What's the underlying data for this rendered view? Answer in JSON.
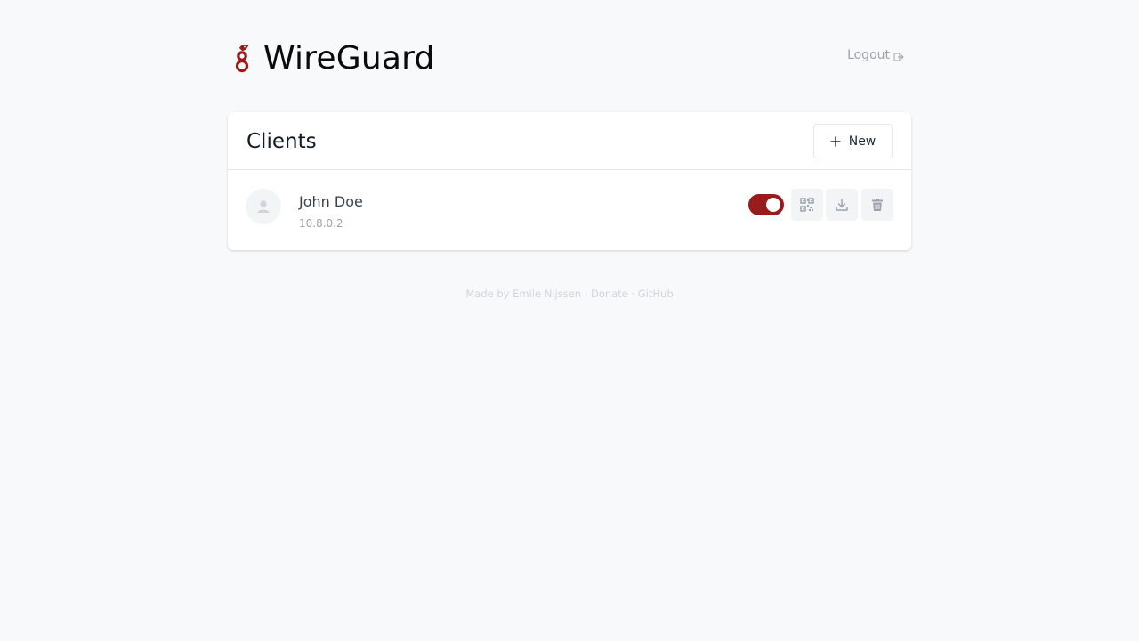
{
  "app": {
    "title": "WireGuard",
    "brand_color": "#991b1b"
  },
  "header": {
    "logout_label": "Logout"
  },
  "clients_card": {
    "title": "Clients",
    "new_button_label": "New",
    "clients": [
      {
        "name": "John Doe",
        "address": "10.8.0.2",
        "enabled": true
      }
    ]
  },
  "footer": {
    "made_by_prefix": "Made by",
    "author": "Emile Nijssen",
    "separator": "·",
    "donate": "Donate",
    "github": "GitHub"
  },
  "icons": {
    "logo": "wireguard-dragon-icon",
    "logout": "logout-arrow-icon",
    "new": "plus-icon",
    "avatar": "user-icon",
    "qr": "qrcode-icon",
    "download": "download-icon",
    "delete": "trash-icon"
  }
}
